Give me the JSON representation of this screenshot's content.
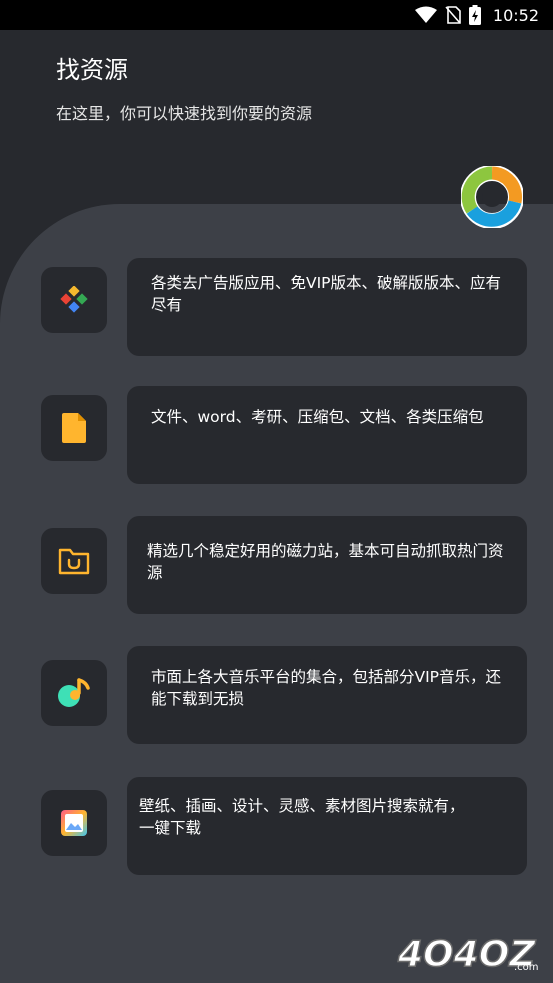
{
  "status_bar": {
    "time": "10:52",
    "icons": [
      "wifi-icon",
      "no-sim-icon",
      "battery-charging-icon"
    ]
  },
  "header": {
    "title": "找资源",
    "subtitle": "在这里，你可以快速找到你要的资源"
  },
  "items": [
    {
      "icon": "diamond-apps-icon",
      "text": "各类去广告版应用、免VIP版本、破解版版本、应有尽有"
    },
    {
      "icon": "document-icon",
      "text": "文件、word、考研、压缩包、文档、各类压缩包"
    },
    {
      "icon": "magnet-folder-icon",
      "text": "精选几个稳定好用的磁力站，基本可自动抓取热门资源"
    },
    {
      "icon": "music-note-icon",
      "text": "市面上各大音乐平台的集合，包括部分VIP音乐，还能下载到无损"
    },
    {
      "icon": "wallpaper-image-icon",
      "text": "壁纸、插画、设计、灵感、素材图片搜索就有，一键下载"
    }
  ],
  "watermark": {
    "text": "4O4OZ",
    "suffix": ".com"
  },
  "colors": {
    "background_top": "#27292e",
    "panel": "#3d4047",
    "card": "#27292e",
    "accent_yellow": "#ffb52e"
  }
}
